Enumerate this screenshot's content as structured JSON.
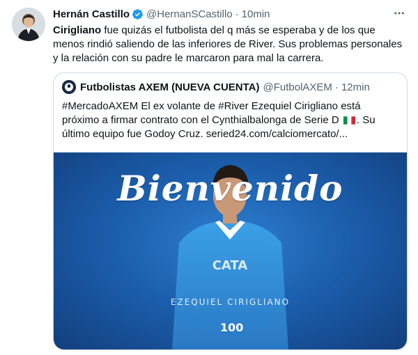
{
  "tweet": {
    "author_name": "Hernán Castillo",
    "author_handle": "@HernanSCastillo",
    "separator": "·",
    "time": "10min",
    "text_bold": "Cirigliano",
    "text_rest": " fue quizás el futbolista del q más se esperaba y de los que menos rindió saliendo de las inferiores de River. Sus problemas personales y la relación con su padre le marcaron para mal la carrera."
  },
  "quoted": {
    "author_name": "Futbolistas AXEM (NUEVA CUENTA)",
    "author_handle": "@FutbolAXEM",
    "separator": "·",
    "time": "12min",
    "text_before_flag": "#MercadoAXEM El ex volante de #River Ezequiel Cirigliano está próximo a firmar contrato con el Cynthialbalonga de Serie D",
    "text_after_flag": ". Su último equipo fue Godoy Cruz. seried24.com/calciomercato/...",
    "image": {
      "headline": "Bienvenido",
      "player_name": "EZEQUIEL CIRIGLIANO",
      "logo_text": "100"
    }
  },
  "icons": {
    "verified": "verified-badge-icon",
    "more": "more-options-icon",
    "flag": "italy-flag-icon"
  },
  "colors": {
    "verified_blue": "#1d9bf0",
    "secondary_text": "#536471",
    "border": "#cfd9de",
    "media_blue": "#1c5fae"
  }
}
